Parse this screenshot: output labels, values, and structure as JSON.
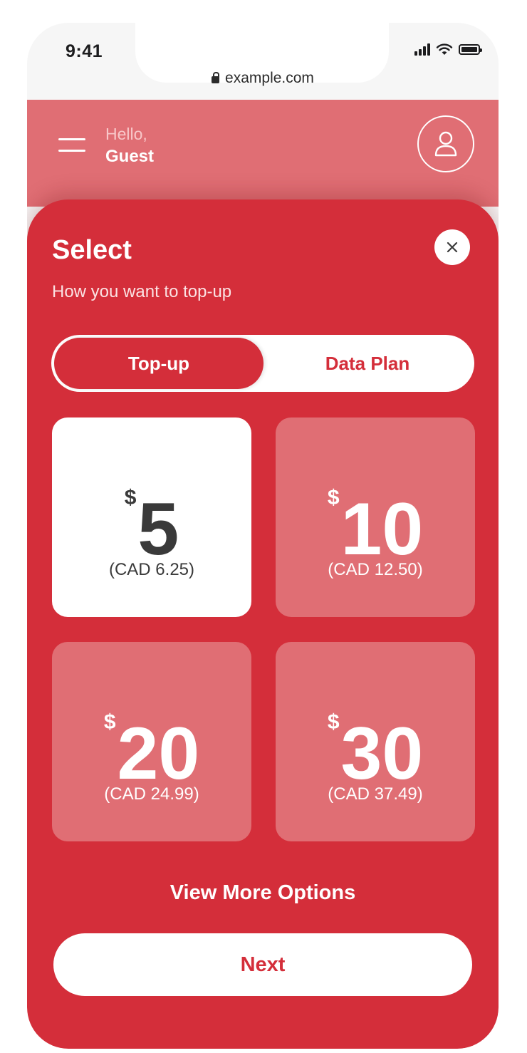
{
  "status_bar": {
    "time": "9:41",
    "url": "example.com",
    "icons": [
      "signal-icon",
      "wifi-icon",
      "battery-icon"
    ]
  },
  "header": {
    "greeting": "Hello,",
    "user_name": "Guest",
    "menu_icon": "hamburger-icon",
    "avatar_icon": "user-icon"
  },
  "sheet": {
    "title": "Select",
    "subtitle": "How you want to top-up",
    "close_icon": "close-icon",
    "tabs": [
      {
        "label": "Top-up",
        "active": true
      },
      {
        "label": "Data Plan",
        "active": false
      }
    ],
    "options": [
      {
        "currency": "$",
        "amount": "5",
        "cad": "(CAD 6.25)",
        "selected": true
      },
      {
        "currency": "$",
        "amount": "10",
        "cad": "(CAD 12.50)",
        "selected": false
      },
      {
        "currency": "$",
        "amount": "20",
        "cad": "(CAD 24.99)",
        "selected": false
      },
      {
        "currency": "$",
        "amount": "30",
        "cad": "(CAD 37.49)",
        "selected": false
      }
    ],
    "view_more_label": "View More Options",
    "next_label": "Next"
  },
  "colors": {
    "brand_red": "#d42e3a",
    "card_pink": "#e06e74",
    "header_pink": "#e06e74"
  }
}
